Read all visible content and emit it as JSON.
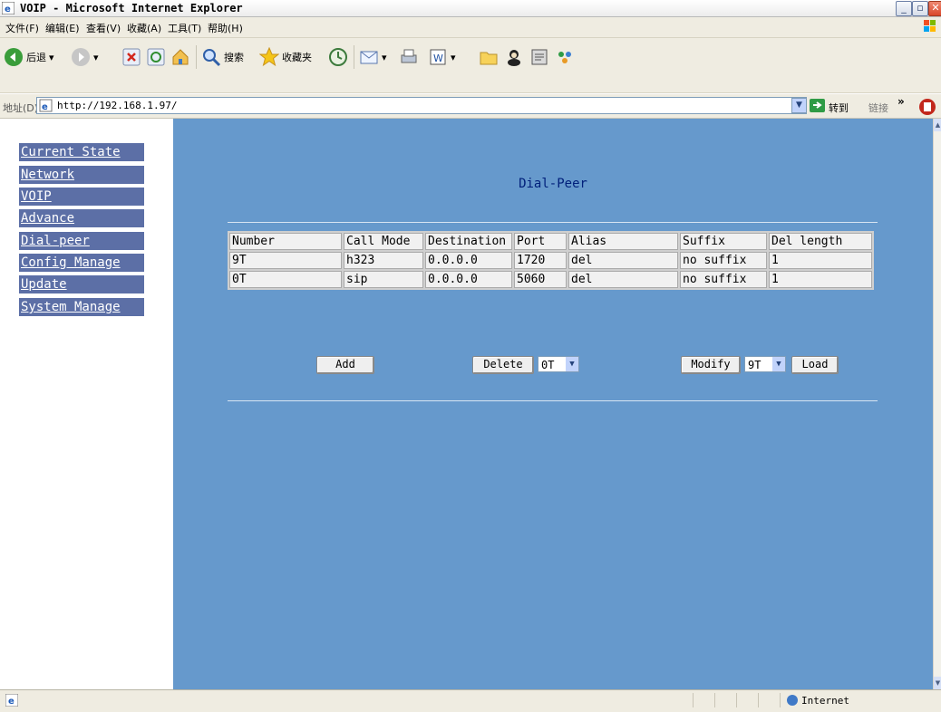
{
  "window": {
    "title": "VOIP - Microsoft Internet Explorer",
    "controls": [
      "minimize",
      "restore",
      "close"
    ]
  },
  "menu": [
    "文件(F)",
    "编辑(E)",
    "查看(V)",
    "收藏(A)",
    "工具(T)",
    "帮助(H)"
  ],
  "toolbar": {
    "back": "后退",
    "search": "搜索",
    "favorites": "收藏夹"
  },
  "address": {
    "label": "地址(D)",
    "url": "http://192.168.1.97/",
    "go": "转到",
    "links": "链接",
    "more": "»"
  },
  "sidebar": {
    "items": [
      "Current State",
      "Network",
      "VOIP",
      "Advance",
      "Dial-peer",
      "Config Manage",
      "Update",
      "System Manage"
    ]
  },
  "main": {
    "title": "Dial-Peer",
    "table": {
      "headers": [
        "Number",
        "Call Mode",
        "Destination",
        "Port",
        "Alias",
        "Suffix",
        "Del length"
      ],
      "rows": [
        [
          "9T",
          "h323",
          "0.0.0.0",
          "1720",
          "del",
          "no suffix",
          "1"
        ],
        [
          "0T",
          "sip",
          "0.0.0.0",
          "5060",
          "del",
          "no suffix",
          "1"
        ]
      ]
    },
    "buttons": {
      "add": "Add",
      "delete": "Delete",
      "delete_select": "0T",
      "modify": "Modify",
      "modify_select": "9T",
      "load": "Load"
    }
  },
  "status": {
    "zone": "Internet"
  },
  "colors": {
    "content_bg": "#6699cc",
    "nav_bg": "#5c6fa6",
    "title_color": "#001f7a"
  }
}
